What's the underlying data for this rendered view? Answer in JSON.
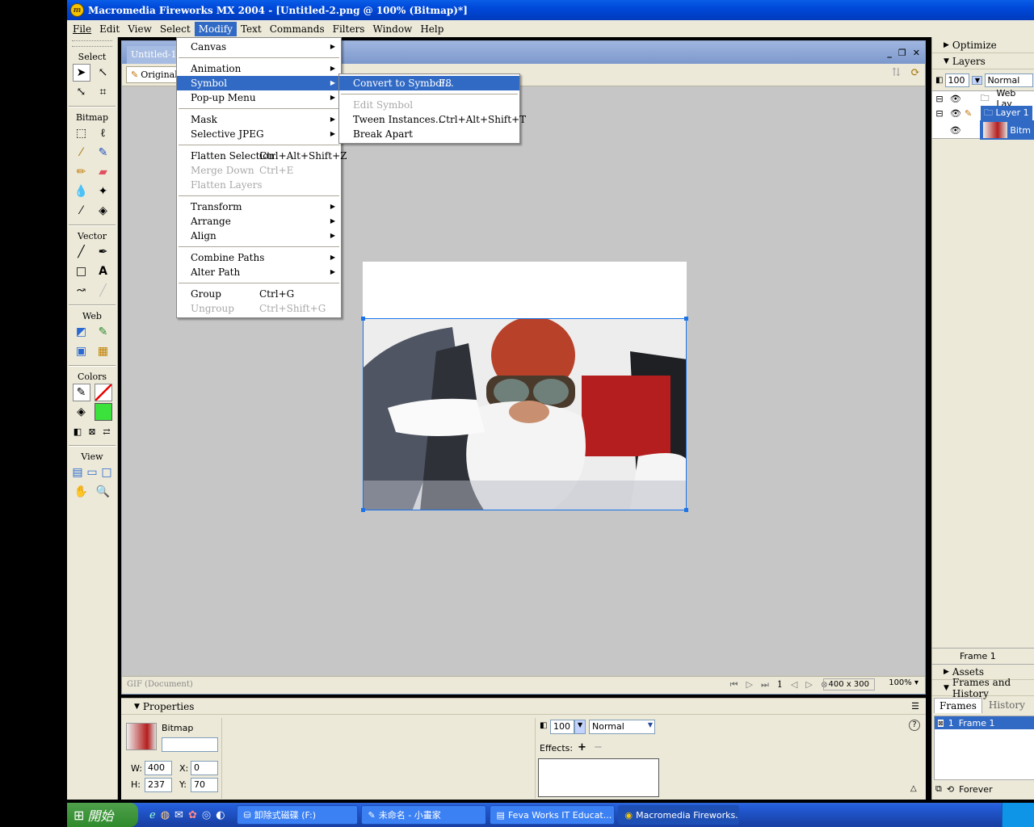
{
  "window": {
    "title": "Macromedia Fireworks MX 2004 - [Untitled-2.png @ 100% (Bitmap)*]",
    "logo": "mx-logo-icon"
  },
  "menubar": [
    "File",
    "Edit",
    "View",
    "Select",
    "Modify",
    "Text",
    "Commands",
    "Filters",
    "Window",
    "Help"
  ],
  "tools": {
    "sections": [
      "Select",
      "Bitmap",
      "Vector",
      "Web",
      "Colors",
      "View"
    ]
  },
  "document": {
    "tab_label": "Untitled-1.p",
    "original_button": "Original",
    "status_label": "GIF (Document)",
    "frame_number": "1",
    "canvas_size": "400 x 300",
    "zoom": "100%"
  },
  "modify_menu": {
    "items": [
      {
        "label": "Canvas",
        "shortcut": "",
        "submenu": true,
        "disabled": false
      },
      {
        "sep": true
      },
      {
        "label": "Animation",
        "shortcut": "",
        "submenu": true,
        "disabled": false
      },
      {
        "label": "Symbol",
        "shortcut": "",
        "submenu": true,
        "disabled": false,
        "highlighted": true
      },
      {
        "label": "Pop-up Menu",
        "shortcut": "",
        "submenu": true,
        "disabled": false
      },
      {
        "sep": true
      },
      {
        "label": "Mask",
        "shortcut": "",
        "submenu": true,
        "disabled": false
      },
      {
        "label": "Selective JPEG",
        "shortcut": "",
        "submenu": true,
        "disabled": false
      },
      {
        "sep": true
      },
      {
        "label": "Flatten Selection",
        "shortcut": "Ctrl+Alt+Shift+Z",
        "submenu": false,
        "disabled": false
      },
      {
        "label": "Merge Down",
        "shortcut": "Ctrl+E",
        "submenu": false,
        "disabled": true
      },
      {
        "label": "Flatten Layers",
        "shortcut": "",
        "submenu": false,
        "disabled": true
      },
      {
        "sep": true
      },
      {
        "label": "Transform",
        "shortcut": "",
        "submenu": true,
        "disabled": false
      },
      {
        "label": "Arrange",
        "shortcut": "",
        "submenu": true,
        "disabled": false
      },
      {
        "label": "Align",
        "shortcut": "",
        "submenu": true,
        "disabled": false
      },
      {
        "sep": true
      },
      {
        "label": "Combine Paths",
        "shortcut": "",
        "submenu": true,
        "disabled": false
      },
      {
        "label": "Alter Path",
        "shortcut": "",
        "submenu": true,
        "disabled": false
      },
      {
        "sep": true
      },
      {
        "label": "Group",
        "shortcut": "Ctrl+G",
        "submenu": false,
        "disabled": false
      },
      {
        "label": "Ungroup",
        "shortcut": "Ctrl+Shift+G",
        "submenu": false,
        "disabled": true
      }
    ]
  },
  "symbol_submenu": {
    "items": [
      {
        "label": "Convert to Symbol...",
        "shortcut": "F8",
        "disabled": false,
        "highlighted": true
      },
      {
        "sep": true
      },
      {
        "label": "Edit Symbol",
        "shortcut": "",
        "disabled": true
      },
      {
        "label": "Tween Instances...",
        "shortcut": "Ctrl+Alt+Shift+T",
        "disabled": false
      },
      {
        "label": "Break Apart",
        "shortcut": "",
        "disabled": false
      }
    ]
  },
  "right_panel": {
    "optimize": "Optimize",
    "layers": "Layers",
    "opacity": "100",
    "blend": "Normal",
    "layer_rows": [
      {
        "name": "Web Lay",
        "selected": false
      },
      {
        "name": "Layer 1",
        "selected": true
      },
      {
        "name": "Bitm",
        "selected": true
      }
    ],
    "frame_label": "Frame 1",
    "assets": "Assets",
    "frames_history": "Frames and History",
    "tabs": [
      "Frames",
      "History"
    ],
    "frame_row_num": "1",
    "frame_row_name": "Frame 1",
    "loop": "Forever"
  },
  "properties": {
    "title": "Properties",
    "object_type": "Bitmap",
    "name_value": "",
    "w_label": "W:",
    "w": "400",
    "h_label": "H:",
    "h": "237",
    "x_label": "X:",
    "x": "0",
    "y_label": "Y:",
    "y": "70",
    "opacity": "100",
    "blend": "Normal",
    "effects_label": "Effects:"
  },
  "taskbar": {
    "start": "開始",
    "buttons": [
      "卸除式磁碟 (F:)",
      "未命名 - 小畫家",
      "Feva Works IT Educat...",
      "Macromedia Fireworks..."
    ]
  }
}
